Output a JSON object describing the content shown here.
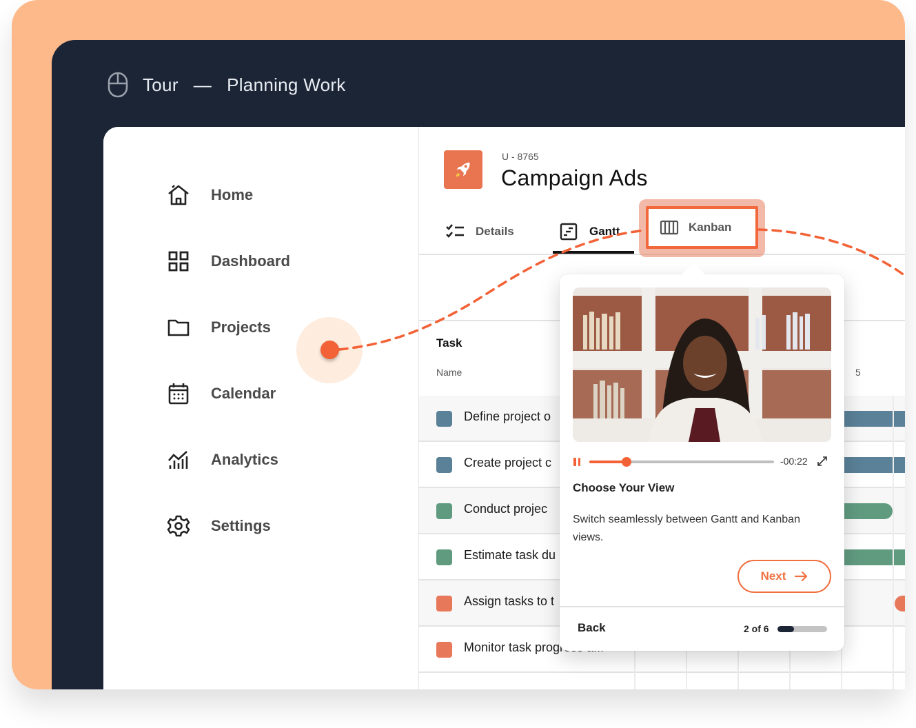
{
  "colors": {
    "accent": "#f36236",
    "frame_dark": "#1b2536",
    "peach": "#fdb98a",
    "task_blue": "#5a8198",
    "task_green": "#609b80",
    "task_orange": "#e8785a"
  },
  "tour": {
    "icon": "mouse-icon",
    "label": "Tour",
    "separator": "—",
    "title": "Planning Work"
  },
  "sidebar": {
    "items": [
      {
        "label": "Home",
        "icon": "home-icon"
      },
      {
        "label": "Dashboard",
        "icon": "dashboard-grid-icon"
      },
      {
        "label": "Projects",
        "icon": "folder-icon"
      },
      {
        "label": "Calendar",
        "icon": "calendar-icon"
      },
      {
        "label": "Analytics",
        "icon": "analytics-chart-icon"
      },
      {
        "label": "Settings",
        "icon": "gear-icon"
      }
    ]
  },
  "project": {
    "icon": "rocket-icon",
    "id": "U - 8765",
    "title": "Campaign Ads"
  },
  "tabs": [
    {
      "label": "Details",
      "icon": "checklist-icon"
    },
    {
      "label": "Gantt",
      "icon": "gantt-icon",
      "active": true
    },
    {
      "label": "Kanban",
      "icon": "kanban-columns-icon",
      "highlighted": true
    }
  ],
  "table": {
    "group_header": "Task",
    "column_header": "Name",
    "timeline_label": "5",
    "rows": [
      {
        "name": "Define project o",
        "color": "#5a8198"
      },
      {
        "name": "Create project c",
        "color": "#5a8198"
      },
      {
        "name": "Conduct projec",
        "color": "#609b80"
      },
      {
        "name": "Estimate task du",
        "color": "#609b80"
      },
      {
        "name": "Assign tasks to t",
        "color": "#e8785a"
      },
      {
        "name": "Monitor task progress a...",
        "color": "#e8785a"
      }
    ]
  },
  "popover": {
    "video": {
      "progress": 0.2,
      "time_remaining": "-00:22",
      "pause_icon": "pause-icon",
      "expand_icon": "expand-icon"
    },
    "title": "Choose Your View",
    "body": "Switch seamlessly between Gantt and Kanban views.",
    "next_label": "Next",
    "back_label": "Back",
    "step": {
      "current": 2,
      "total": 6,
      "label": "2 of 6"
    }
  }
}
